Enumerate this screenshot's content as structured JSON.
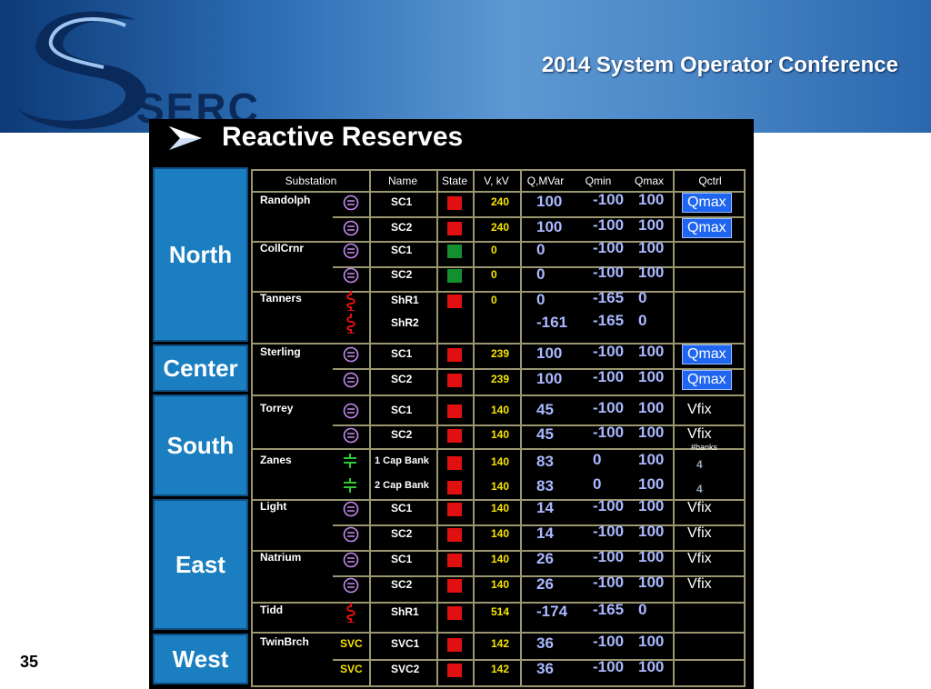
{
  "conference_title": "2014 System Operator Conference",
  "logo_text": "SERC",
  "slide_number": "35",
  "panel_title": "Reactive Reserves",
  "regions": [
    "North",
    "Center",
    "South",
    "East",
    "West"
  ],
  "headers": {
    "substation": "Substation",
    "name": "Name",
    "state": "State",
    "kv": "V, kV",
    "q": "Q,MVar",
    "qmin": "Qmin",
    "qmax": "Qmax",
    "qctrl": "Qctrl"
  },
  "rows": [
    {
      "sub": "Randolph",
      "name": "SC1",
      "kv": "240",
      "q": "100",
      "qmin": "-100",
      "qmax": "100",
      "ctrl": "Qmax"
    },
    {
      "sub": "",
      "name": "SC2",
      "kv": "240",
      "q": "100",
      "qmin": "-100",
      "qmax": "100",
      "ctrl": "Qmax"
    },
    {
      "sub": "CollCrnr",
      "name": "SC1",
      "kv": "0",
      "q": "0",
      "qmin": "-100",
      "qmax": "100",
      "ctrl": ""
    },
    {
      "sub": "",
      "name": "SC2",
      "kv": "0",
      "q": "0",
      "qmin": "-100",
      "qmax": "100",
      "ctrl": ""
    },
    {
      "sub": "Tanners",
      "name": "ShR1",
      "kv": "0",
      "q": "0",
      "qmin": "-165",
      "qmax": "0",
      "ctrl": ""
    },
    {
      "sub": "",
      "name": "ShR2",
      "kv": "",
      "q": "-161",
      "qmin": "-165",
      "qmax": "0",
      "ctrl": ""
    },
    {
      "sub": "Sterling",
      "name": "SC1",
      "kv": "239",
      "q": "100",
      "qmin": "-100",
      "qmax": "100",
      "ctrl": "Qmax"
    },
    {
      "sub": "",
      "name": "SC2",
      "kv": "239",
      "q": "100",
      "qmin": "-100",
      "qmax": "100",
      "ctrl": "Qmax"
    },
    {
      "sub": "Torrey",
      "name": "SC1",
      "kv": "140",
      "q": "45",
      "qmin": "-100",
      "qmax": "100",
      "ctrl": "Vfix"
    },
    {
      "sub": "",
      "name": "SC2",
      "kv": "140",
      "q": "45",
      "qmin": "-100",
      "qmax": "100",
      "ctrl": "Vfix"
    },
    {
      "sub": "Zanes",
      "name": "1 Cap Bank",
      "kv": "140",
      "q": "83",
      "qmin": "0",
      "qmax": "100",
      "ctrl": "4"
    },
    {
      "sub": "",
      "name": "2 Cap Bank",
      "kv": "140",
      "q": "83",
      "qmin": "0",
      "qmax": "100",
      "ctrl": "4"
    },
    {
      "sub": "Light",
      "name": "SC1",
      "kv": "140",
      "q": "14",
      "qmin": "-100",
      "qmax": "100",
      "ctrl": "Vfix"
    },
    {
      "sub": "",
      "name": "SC2",
      "kv": "140",
      "q": "14",
      "qmin": "-100",
      "qmax": "100",
      "ctrl": "Vfix"
    },
    {
      "sub": "Natrium",
      "name": "SC1",
      "kv": "140",
      "q": "26",
      "qmin": "-100",
      "qmax": "100",
      "ctrl": "Vfix"
    },
    {
      "sub": "",
      "name": "SC2",
      "kv": "140",
      "q": "26",
      "qmin": "-100",
      "qmax": "100",
      "ctrl": "Vfix"
    },
    {
      "sub": "Tidd",
      "name": "ShR1",
      "kv": "514",
      "q": "-174",
      "qmin": "-165",
      "qmax": "0",
      "ctrl": ""
    },
    {
      "sub": "TwinBrch",
      "name": "SVC1",
      "kv": "142",
      "q": "36",
      "qmin": "-100",
      "qmax": "100",
      "ctrl": ""
    },
    {
      "sub": "",
      "name": "SVC2",
      "kv": "142",
      "q": "36",
      "qmin": "-100",
      "qmax": "100",
      "ctrl": ""
    }
  ],
  "banks_label": "#banks",
  "svc_label": "SVC",
  "colors": {
    "region_blue": "#1a7ec0",
    "ctrl_blue": "#1f65ef",
    "state_red": "#e01010",
    "state_green": "#129030",
    "kv_yellow": "#f7e400",
    "grid": "#9a9670"
  }
}
